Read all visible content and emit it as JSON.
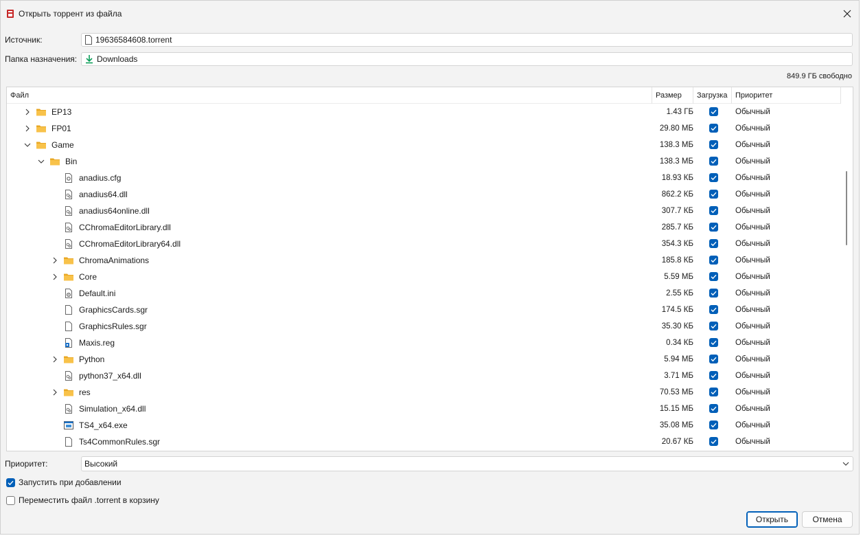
{
  "window": {
    "title": "Открыть торрент из файла"
  },
  "source": {
    "label": "Источник:",
    "value": "19636584608.torrent"
  },
  "destination": {
    "label": "Папка назначения:",
    "value": "Downloads"
  },
  "free_space": "849.9 ГБ свободно",
  "columns": {
    "file": "Файл",
    "size": "Размер",
    "download": "Загрузка",
    "priority": "Приоритет"
  },
  "rows": [
    {
      "name": "EP13",
      "size": "1.43 ГБ",
      "priority": "Обычный",
      "type": "folder",
      "depth": 0,
      "expander": "collapsed",
      "checked": true
    },
    {
      "name": "FP01",
      "size": "29.80 МБ",
      "priority": "Обычный",
      "type": "folder",
      "depth": 0,
      "expander": "collapsed",
      "checked": true
    },
    {
      "name": "Game",
      "size": "138.3 МБ",
      "priority": "Обычный",
      "type": "folder",
      "depth": 0,
      "expander": "expanded",
      "checked": true
    },
    {
      "name": "Bin",
      "size": "138.3 МБ",
      "priority": "Обычный",
      "type": "folder",
      "depth": 1,
      "expander": "expanded",
      "checked": true
    },
    {
      "name": "anadius.cfg",
      "size": "18.93 КБ",
      "priority": "Обычный",
      "type": "cfg",
      "depth": 2,
      "expander": "none",
      "checked": true
    },
    {
      "name": "anadius64.dll",
      "size": "862.2 КБ",
      "priority": "Обычный",
      "type": "dll",
      "depth": 2,
      "expander": "none",
      "checked": true
    },
    {
      "name": "anadius64online.dll",
      "size": "307.7 КБ",
      "priority": "Обычный",
      "type": "dll",
      "depth": 2,
      "expander": "none",
      "checked": true
    },
    {
      "name": "CChromaEditorLibrary.dll",
      "size": "285.7 КБ",
      "priority": "Обычный",
      "type": "dll",
      "depth": 2,
      "expander": "none",
      "checked": true
    },
    {
      "name": "CChromaEditorLibrary64.dll",
      "size": "354.3 КБ",
      "priority": "Обычный",
      "type": "dll",
      "depth": 2,
      "expander": "none",
      "checked": true
    },
    {
      "name": "ChromaAnimations",
      "size": "185.8 КБ",
      "priority": "Обычный",
      "type": "folder",
      "depth": 2,
      "expander": "collapsed",
      "checked": true
    },
    {
      "name": "Core",
      "size": "5.59 МБ",
      "priority": "Обычный",
      "type": "folder",
      "depth": 2,
      "expander": "collapsed",
      "checked": true
    },
    {
      "name": "Default.ini",
      "size": "2.55 КБ",
      "priority": "Обычный",
      "type": "ini",
      "depth": 2,
      "expander": "none",
      "checked": true
    },
    {
      "name": "GraphicsCards.sgr",
      "size": "174.5 КБ",
      "priority": "Обычный",
      "type": "file",
      "depth": 2,
      "expander": "none",
      "checked": true
    },
    {
      "name": "GraphicsRules.sgr",
      "size": "35.30 КБ",
      "priority": "Обычный",
      "type": "file",
      "depth": 2,
      "expander": "none",
      "checked": true
    },
    {
      "name": "Maxis.reg",
      "size": "0.34 КБ",
      "priority": "Обычный",
      "type": "reg",
      "depth": 2,
      "expander": "none",
      "checked": true
    },
    {
      "name": "Python",
      "size": "5.94 МБ",
      "priority": "Обычный",
      "type": "folder",
      "depth": 2,
      "expander": "collapsed",
      "checked": true
    },
    {
      "name": "python37_x64.dll",
      "size": "3.71 МБ",
      "priority": "Обычный",
      "type": "dll",
      "depth": 2,
      "expander": "none",
      "checked": true
    },
    {
      "name": "res",
      "size": "70.53 МБ",
      "priority": "Обычный",
      "type": "folder",
      "depth": 2,
      "expander": "collapsed",
      "checked": true
    },
    {
      "name": "Simulation_x64.dll",
      "size": "15.15 МБ",
      "priority": "Обычный",
      "type": "dll",
      "depth": 2,
      "expander": "none",
      "checked": true
    },
    {
      "name": "TS4_x64.exe",
      "size": "35.08 МБ",
      "priority": "Обычный",
      "type": "exe",
      "depth": 2,
      "expander": "none",
      "checked": true
    },
    {
      "name": "Ts4CommonRules.sgr",
      "size": "20.67 КБ",
      "priority": "Обычный",
      "type": "file",
      "depth": 2,
      "expander": "none",
      "checked": true
    }
  ],
  "priority": {
    "label": "Приоритет:",
    "value": "Высокий"
  },
  "options": {
    "start_on_add": {
      "label": "Запустить при добавлении",
      "checked": true
    },
    "move_to_trash": {
      "label": "Переместить файл .torrent в корзину",
      "checked": false
    }
  },
  "buttons": {
    "open": "Открыть",
    "cancel": "Отмена"
  },
  "colors": {
    "accent": "#005fb8",
    "folder": "#f8c24a",
    "download_icon": "#0a9d58"
  }
}
